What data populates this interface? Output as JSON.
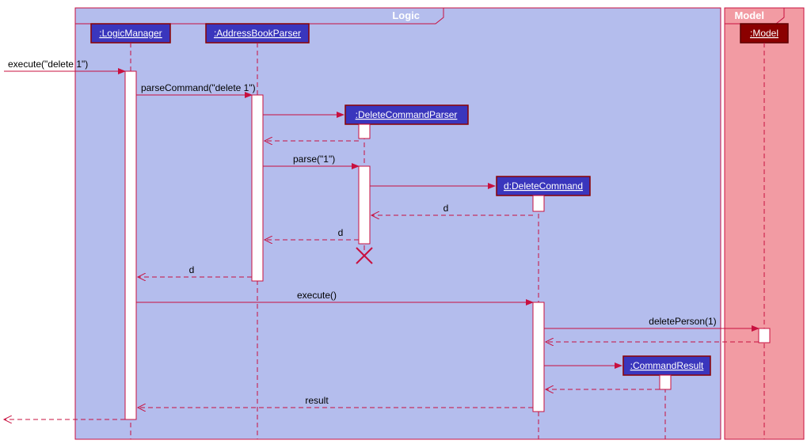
{
  "chart_data": {
    "type": "sequence-diagram",
    "frames": [
      {
        "name": "Logic",
        "participants": [
          "LogicManager",
          "AddressBookParser",
          "DeleteCommandParser",
          "DeleteCommand",
          "CommandResult"
        ]
      },
      {
        "name": "Model",
        "participants": [
          "Model"
        ]
      }
    ],
    "participants": [
      {
        "id": "logicManager",
        "label": ":LogicManager"
      },
      {
        "id": "addressBookParser",
        "label": ":AddressBookParser"
      },
      {
        "id": "deleteCommandParser",
        "label": ":DeleteCommandParser",
        "created_by": "parseCommand"
      },
      {
        "id": "deleteCommand",
        "label": "d:DeleteCommand",
        "created_by": "parse"
      },
      {
        "id": "commandResult",
        "label": ":CommandResult",
        "created_by": "execute"
      },
      {
        "id": "model",
        "label": ":Model"
      }
    ],
    "messages": [
      {
        "from": "external",
        "to": "logicManager",
        "label": "execute(\"delete 1\")",
        "type": "call"
      },
      {
        "from": "logicManager",
        "to": "addressBookParser",
        "label": "parseCommand(\"delete 1\")",
        "type": "call"
      },
      {
        "from": "addressBookParser",
        "to": "deleteCommandParser",
        "label": "",
        "type": "create"
      },
      {
        "from": "deleteCommandParser",
        "to": "addressBookParser",
        "label": "",
        "type": "return"
      },
      {
        "from": "addressBookParser",
        "to": "deleteCommandParser",
        "label": "parse(\"1\")",
        "type": "call"
      },
      {
        "from": "deleteCommandParser",
        "to": "deleteCommand",
        "label": "",
        "type": "create"
      },
      {
        "from": "deleteCommand",
        "to": "deleteCommandParser",
        "label": "d",
        "type": "return"
      },
      {
        "from": "deleteCommandParser",
        "to": "addressBookParser",
        "label": "d",
        "type": "return"
      },
      {
        "from": "deleteCommandParser",
        "to": null,
        "label": "",
        "type": "destroy"
      },
      {
        "from": "addressBookParser",
        "to": "logicManager",
        "label": "d",
        "type": "return"
      },
      {
        "from": "logicManager",
        "to": "deleteCommand",
        "label": "execute()",
        "type": "call"
      },
      {
        "from": "deleteCommand",
        "to": "model",
        "label": "deletePerson(1)",
        "type": "call"
      },
      {
        "from": "model",
        "to": "deleteCommand",
        "label": "",
        "type": "return"
      },
      {
        "from": "deleteCommand",
        "to": "commandResult",
        "label": "",
        "type": "create"
      },
      {
        "from": "commandResult",
        "to": "deleteCommand",
        "label": "",
        "type": "return"
      },
      {
        "from": "deleteCommand",
        "to": "logicManager",
        "label": "result",
        "type": "return"
      },
      {
        "from": "logicManager",
        "to": "external",
        "label": "",
        "type": "return"
      }
    ]
  },
  "frames": {
    "logic": "Logic",
    "model": "Model"
  },
  "objects": {
    "logicManager": ":LogicManager",
    "addressBookParser": ":AddressBookParser",
    "deleteCommandParser": ":DeleteCommandParser",
    "deleteCommand": "d:DeleteCommand",
    "commandResult": ":CommandResult",
    "model": ":Model"
  },
  "messages": {
    "executeDelete1": "execute(\"delete 1\")",
    "parseCommand": "parseCommand(\"delete 1\")",
    "parse1": "parse(\"1\")",
    "d1": "d",
    "d2": "d",
    "d3": "d",
    "execute": "execute()",
    "deletePerson": "deletePerson(1)",
    "result": "result"
  }
}
